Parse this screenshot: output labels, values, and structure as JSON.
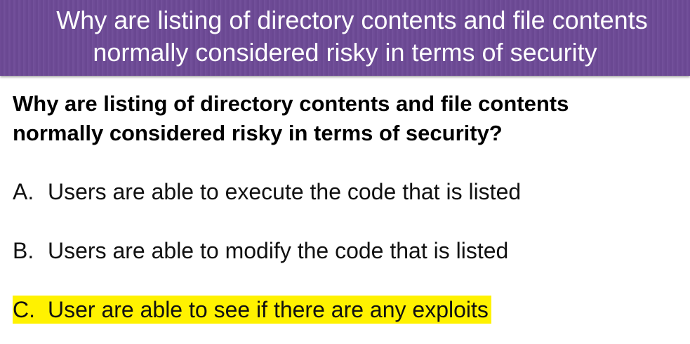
{
  "slide": {
    "title_line1": "Why are listing of directory contents and file contents",
    "title_line2": "normally considered risky in terms of security"
  },
  "question": {
    "line1": "Why are listing of directory contents and file contents",
    "line2": "normally considered risky in terms of security?"
  },
  "options": [
    {
      "letter": "A.",
      "text": "Users are able to execute the code that is listed",
      "highlighted": false
    },
    {
      "letter": "B.",
      "text": "Users are able to modify the code that is listed",
      "highlighted": false
    },
    {
      "letter": "C.",
      "text": "User are able to see if there are any exploits",
      "highlighted": true
    }
  ],
  "colors": {
    "header_bg": "#6e4b96",
    "header_text": "#ffffff",
    "highlight": "#fff200"
  }
}
